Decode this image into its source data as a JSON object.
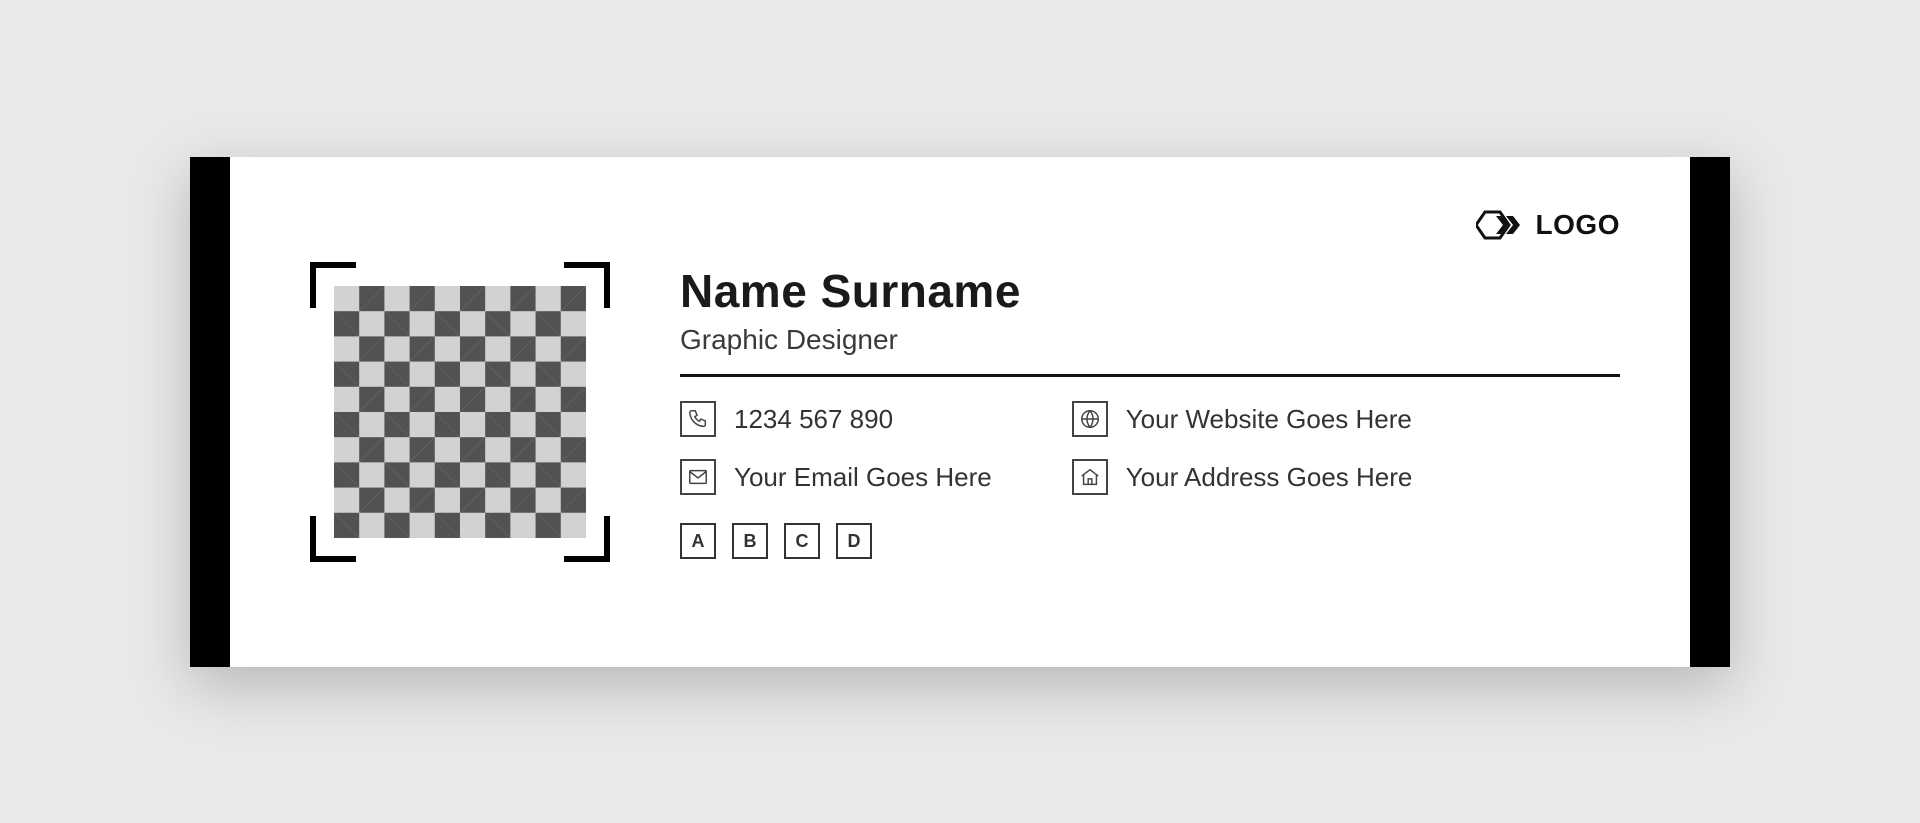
{
  "logo_text": "LOGO",
  "name": "Name Surname",
  "job_title": "Graphic Designer",
  "contacts": {
    "phone": {
      "icon": "phone-icon",
      "value": "1234 567 890"
    },
    "email": {
      "icon": "email-icon",
      "value": "Your Email Goes Here"
    },
    "website": {
      "icon": "globe-icon",
      "value": "Your Website Goes Here"
    },
    "address": {
      "icon": "home-icon",
      "value": "Your Address Goes Here"
    }
  },
  "socials": [
    "A",
    "B",
    "C",
    "D"
  ]
}
